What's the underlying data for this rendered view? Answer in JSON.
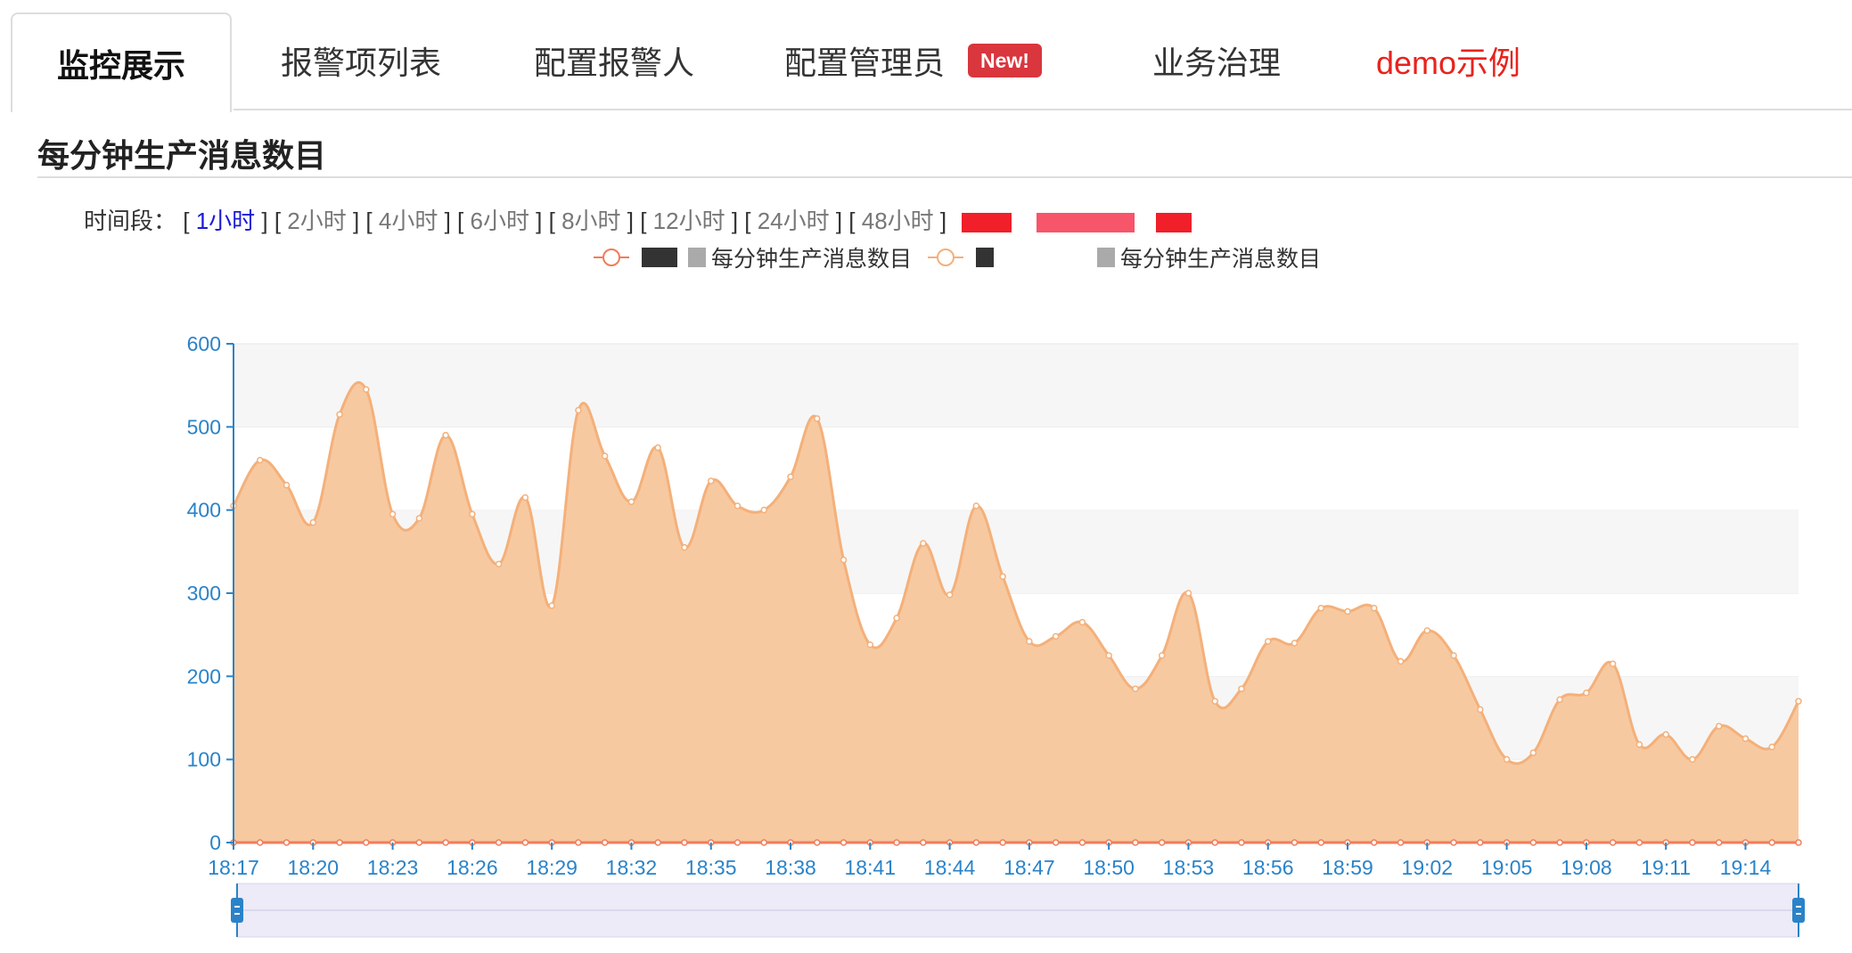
{
  "tabs": [
    {
      "label": "监控展示",
      "active": true
    },
    {
      "label": "报警项列表"
    },
    {
      "label": "配置报警人"
    },
    {
      "label": "配置管理员",
      "badge": "New!"
    },
    {
      "label": "业务治理"
    },
    {
      "label": "demo示例",
      "color": "#e8231e"
    }
  ],
  "section": {
    "title": "每分钟生产消息数目"
  },
  "timebar": {
    "label": "时间段：",
    "options": [
      "1小时",
      "2小时",
      "4小时",
      "6小时",
      "8小时",
      "12小时",
      "24小时",
      "48小时"
    ],
    "selected_index": 0
  },
  "colors": {
    "area": "#f7c9a0",
    "area_line": "#f4b07a",
    "series2": "#f07c5a",
    "axis": "#2a83c8",
    "zoom_fill": "#ecebf7",
    "zoom_handle": "#2a83c8"
  },
  "chart_data": {
    "type": "area",
    "x_ticks": [
      "18:17",
      "18:20",
      "18:23",
      "18:26",
      "18:29",
      "18:32",
      "18:35",
      "18:38",
      "18:41",
      "18:44",
      "18:47",
      "18:50",
      "18:53",
      "18:56",
      "18:59",
      "19:02",
      "19:05",
      "19:08",
      "19:11",
      "19:14"
    ],
    "ylim": [
      0,
      600
    ],
    "y_ticks": [
      0,
      100,
      200,
      300,
      400,
      500,
      600
    ],
    "series": [
      {
        "name": "每分钟生产消息数目",
        "style": "area",
        "values": [
          405,
          460,
          430,
          385,
          515,
          545,
          395,
          390,
          490,
          395,
          335,
          415,
          285,
          520,
          465,
          410,
          475,
          355,
          435,
          405,
          400,
          440,
          510,
          340,
          238,
          270,
          360,
          298,
          405,
          320,
          242,
          248,
          265,
          225,
          185,
          225,
          300,
          170,
          185,
          242,
          240,
          282,
          278,
          282,
          218,
          255,
          225,
          160,
          100,
          108,
          172,
          180,
          215,
          118,
          130,
          100,
          140,
          125,
          115,
          170
        ]
      },
      {
        "name": "每分钟生产消息数目",
        "style": "line",
        "values": [
          0,
          0,
          0,
          0,
          0,
          0,
          0,
          0,
          0,
          0,
          0,
          0,
          0,
          0,
          0,
          0,
          0,
          0,
          0,
          0,
          0,
          0,
          0,
          0,
          0,
          0,
          0,
          0,
          0,
          0,
          0,
          0,
          0,
          0,
          0,
          0,
          0,
          0,
          0,
          0,
          0,
          0,
          0,
          0,
          0,
          0,
          0,
          0,
          0,
          0,
          0,
          0,
          0,
          0,
          0,
          0,
          0,
          0,
          0,
          0
        ]
      }
    ]
  }
}
